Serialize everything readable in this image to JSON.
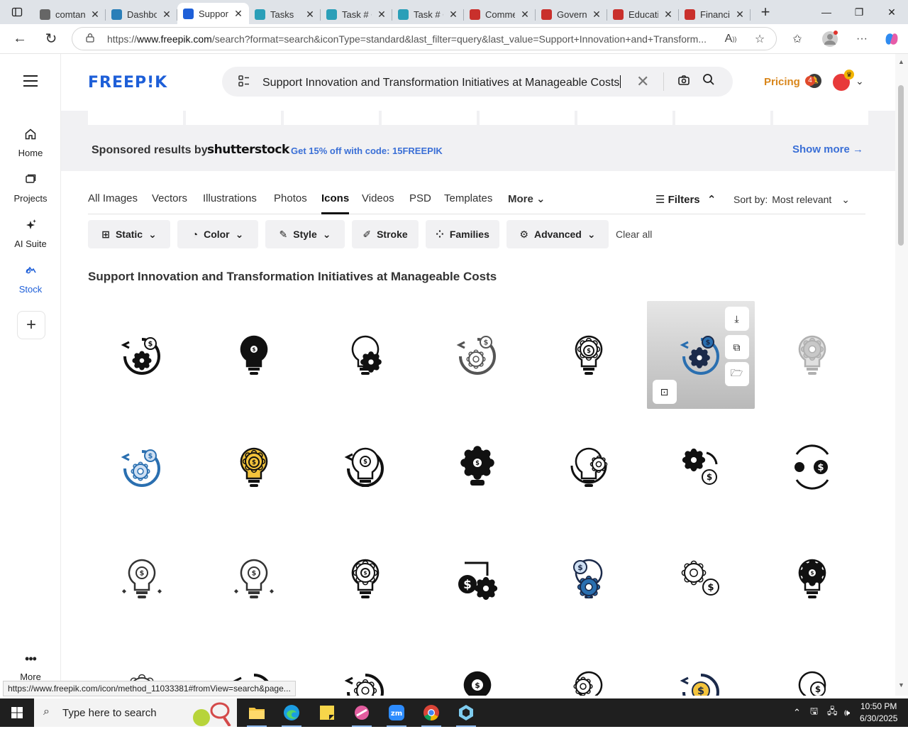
{
  "browser": {
    "tabs": [
      {
        "label": "comtan",
        "icon_color": "#666666"
      },
      {
        "label": "Dashbo",
        "icon_color": "#2b7fb8"
      },
      {
        "label": "Suppor",
        "icon_color": "#1e5fd8",
        "active": true
      },
      {
        "label": "Tasks",
        "icon_color": "#2b9fb8"
      },
      {
        "label": "Task # C",
        "icon_color": "#2b9fb8"
      },
      {
        "label": "Task # C",
        "icon_color": "#2b9fb8"
      },
      {
        "label": "Comme",
        "icon_color": "#c9302c"
      },
      {
        "label": "Govern",
        "icon_color": "#c9302c"
      },
      {
        "label": "Educati",
        "icon_color": "#c9302c"
      },
      {
        "label": "Financi",
        "icon_color": "#c9302c"
      }
    ],
    "url_prefix": "https://",
    "url_domain": "www.freepik.com",
    "url_rest": "/search?format=search&iconType=standard&last_filter=query&last_value=Support+Innovation+and+Transform..."
  },
  "rail": {
    "items": [
      {
        "label": "Home",
        "icon": "house-icon"
      },
      {
        "label": "Projects",
        "icon": "folder-icon"
      },
      {
        "label": "AI Suite",
        "icon": "sparkle-icon"
      },
      {
        "label": "Stock",
        "icon": "stock-icon",
        "active": true
      }
    ],
    "more_label": "More"
  },
  "header": {
    "logo": "FREEP!K",
    "search_query": "Support Innovation and Transformation Initiatives at Manageable Costs",
    "pricing": "Pricing",
    "notif_count": "4"
  },
  "sponsored": {
    "label": "Sponsored results by",
    "brand": "shutterstock",
    "promo": "Get 15% off with code: 15FREEPIK",
    "show_more": "Show more →"
  },
  "type_tabs": [
    {
      "label": "All Images"
    },
    {
      "label": "Vectors"
    },
    {
      "label": "Illustrations"
    },
    {
      "label": "Photos"
    },
    {
      "label": "Icons",
      "active": true
    },
    {
      "label": "Videos"
    },
    {
      "label": "PSD"
    },
    {
      "label": "Templates"
    },
    {
      "label": "More"
    }
  ],
  "toolbar": {
    "filters": "Filters",
    "sort_label": "Sort by:",
    "sort_value": "Most relevant"
  },
  "chips": [
    {
      "label": "Static",
      "icon": "static-icon",
      "dropdown": true
    },
    {
      "label": "Color",
      "icon": "palette-icon",
      "dropdown": true
    },
    {
      "label": "Style",
      "icon": "brush-icon",
      "dropdown": true
    },
    {
      "label": "Stroke",
      "icon": "pen-icon",
      "dropdown": false
    },
    {
      "label": "Families",
      "icon": "families-icon",
      "dropdown": false
    },
    {
      "label": "Advanced",
      "icon": "gear-icon",
      "dropdown": true
    }
  ],
  "clear_all": "Clear all",
  "results_heading": "Support Innovation and Transformation Initiatives at Manageable Costs",
  "colors": {
    "brand_blue": "#1e5fd8",
    "pricing_orange": "#d9861b",
    "icon_blue": "#2a6fb0",
    "icon_yellow": "#f3c33b",
    "icon_navy": "#1b2a4a"
  },
  "status_url": "https://www.freepik.com/icon/method_11033381#fromView=search&page...",
  "taskbar": {
    "search_placeholder": "Type here to search",
    "time": "10:50 PM",
    "date": "6/30/2025"
  }
}
